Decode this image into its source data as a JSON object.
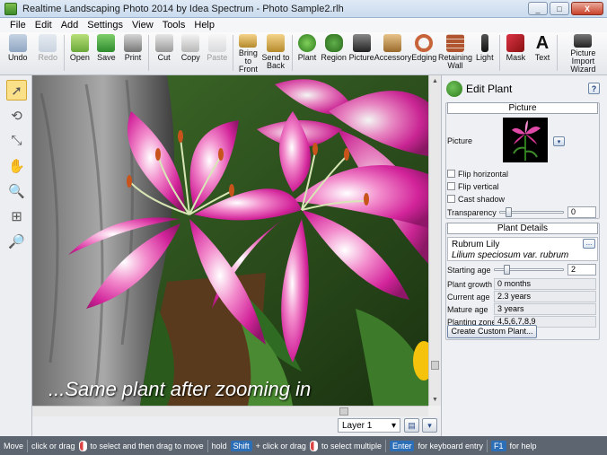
{
  "window": {
    "title": "Realtime Landscaping Photo 2014 by Idea Spectrum - Photo Sample2.rlh",
    "minimize_label": "_",
    "maximize_label": "□",
    "close_label": "X"
  },
  "menu": [
    "File",
    "Edit",
    "Add",
    "Settings",
    "View",
    "Tools",
    "Help"
  ],
  "toolbar": [
    {
      "label": "Undo",
      "icon": "undo-icon",
      "enabled": true
    },
    {
      "label": "Redo",
      "icon": "redo-icon",
      "enabled": false
    },
    {
      "label": "Open",
      "icon": "open-folder-icon",
      "enabled": true
    },
    {
      "label": "Save",
      "icon": "save-icon",
      "enabled": true
    },
    {
      "label": "Print",
      "icon": "print-icon",
      "enabled": true
    },
    {
      "label": "Cut",
      "icon": "scissors-icon",
      "enabled": true
    },
    {
      "label": "Copy",
      "icon": "copy-icon",
      "enabled": true
    },
    {
      "label": "Paste",
      "icon": "paste-icon",
      "enabled": false
    },
    {
      "label": "Bring to\nFront",
      "icon": "bring-front-icon",
      "enabled": true
    },
    {
      "label": "Send to\nBack",
      "icon": "send-back-icon",
      "enabled": true
    },
    {
      "label": "Plant",
      "icon": "plant-icon",
      "enabled": true
    },
    {
      "label": "Region",
      "icon": "region-icon",
      "enabled": true
    },
    {
      "label": "Picture",
      "icon": "camera-icon",
      "enabled": true
    },
    {
      "label": "Accessory",
      "icon": "accessory-icon",
      "enabled": true
    },
    {
      "label": "Edging",
      "icon": "edging-icon",
      "enabled": true
    },
    {
      "label": "Retaining\nWall",
      "icon": "retaining-wall-icon",
      "enabled": true
    },
    {
      "label": "Light",
      "icon": "light-icon",
      "enabled": true
    },
    {
      "label": "Mask",
      "icon": "mask-icon",
      "enabled": true
    },
    {
      "label": "Text",
      "icon": "text-icon",
      "enabled": true
    },
    {
      "label": "Picture Import\nWizard",
      "icon": "wizard-icon",
      "enabled": true
    }
  ],
  "tools": [
    "select-arrow-icon",
    "rotate-icon",
    "resize-icon",
    "pan-hand-icon",
    "zoom-in-icon",
    "zoom-fit-icon",
    "zoom-out-icon"
  ],
  "canvas": {
    "caption": "...Same plant after zooming in"
  },
  "layers": {
    "current": "Layer 1"
  },
  "panel": {
    "title": "Edit Plant",
    "help_label": "?",
    "picture_section": "Picture",
    "picture_label": "Picture",
    "flip_horizontal": "Flip horizontal",
    "flip_vertical": "Flip vertical",
    "cast_shadow": "Cast shadow",
    "transparency_label": "Transparency",
    "transparency_value": "0",
    "transparency_fraction": 0.1,
    "details_section": "Plant Details",
    "common_name": "Rubrum Lily",
    "latin_name": "Lilium speciosum var. rubrum",
    "more_label": "...",
    "starting_age_label": "Starting age",
    "starting_age_value": "2",
    "starting_age_fraction": 0.15,
    "plant_growth_label": "Plant growth",
    "plant_growth_value": "0 months",
    "current_age_label": "Current age",
    "current_age_value": "2.3 years",
    "mature_age_label": "Mature age",
    "mature_age_value": "3 years",
    "planting_zones_label": "Planting zones",
    "planting_zones_value": "4,5,6,7,8,9",
    "create_button": "Create Custom Plant..."
  },
  "status": {
    "mode": "Move",
    "hint1": "click or drag",
    "hint2": "to select and then drag to move",
    "hold": "hold",
    "shift_key": "Shift",
    "plus": "+ click or drag",
    "hint3": "to select multiple",
    "enter_key": "Enter",
    "enter_hint": "for keyboard entry",
    "f1_key": "F1",
    "f1_hint": "for help"
  },
  "colors": {
    "accent": "#2c6fb7",
    "status_bg": "#5c6570",
    "tool_active": "#fbe08a"
  }
}
